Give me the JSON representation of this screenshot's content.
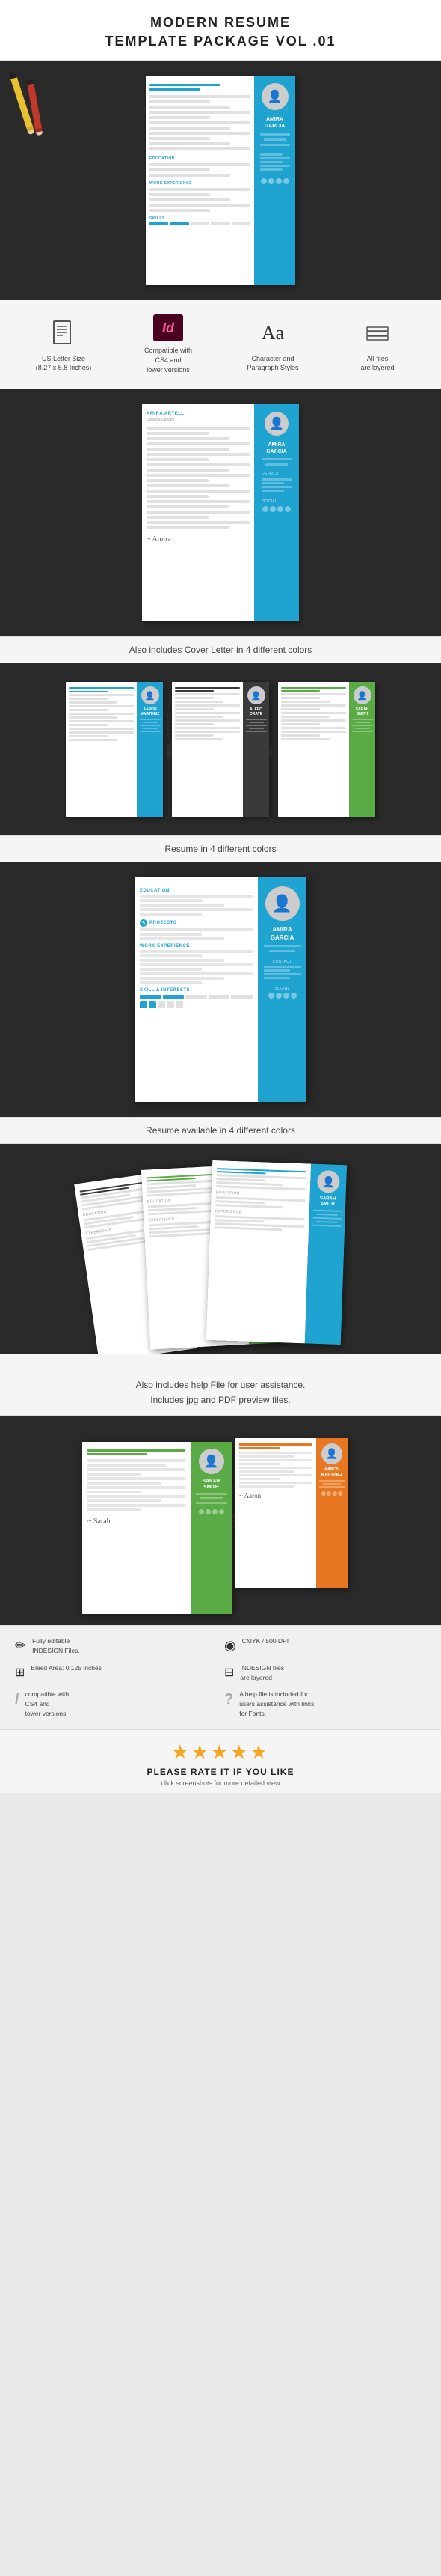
{
  "header": {
    "title": "MODERN RESUME\nTEMPLATE PACKAGE VOL .01"
  },
  "features": [
    {
      "icon_name": "letter-size-icon",
      "icon_symbol": "📄",
      "label": "US Letter Size\n(8.27 x 5.8 Inches)"
    },
    {
      "icon_name": "indesign-icon",
      "icon_symbol": "Id",
      "label": "Compatible with\nCS4 and\nlower versions"
    },
    {
      "icon_name": "typography-icon",
      "icon_symbol": "Aa",
      "label": "Character and\nParagraph Styles"
    },
    {
      "icon_name": "layers-icon",
      "icon_symbol": "⊞",
      "label": "All files\nare layered"
    }
  ],
  "section_labels": {
    "cover_letter": "Also includes Cover Letter in 4 different colors",
    "resume_colors": "Resume in 4 different colors",
    "resume_available": "Resume available in 4 different colors",
    "help_files": "Also includes help File for user assistance.\nIncludes jpg and PDF preview files."
  },
  "bottom_features": [
    {
      "icon_name": "edit-icon",
      "icon_symbol": "✏",
      "text": "Fully editable\nINDESIGN Files."
    },
    {
      "icon_name": "color-icon",
      "icon_symbol": "◉",
      "text": "CMYK / 500 DPI"
    },
    {
      "icon_name": "crop-icon",
      "icon_symbol": "⊞",
      "text": "Bleed Area: 0.125 inches"
    },
    {
      "icon_name": "layers2-icon",
      "icon_symbol": "⊟",
      "text": "INDESIGN files\nare layered"
    },
    {
      "icon_name": "compatible-icon",
      "icon_symbol": "/",
      "text": "compatible with\nCS4 and\ntower versions"
    },
    {
      "icon_name": "help-icon",
      "icon_symbol": "?",
      "text": "A help file is included for\nusers assistance with links\nfor Fonts."
    }
  ],
  "rating": {
    "stars": "★★★★★",
    "title": "PLEASE RATE IT IF YOU LIKE",
    "subtitle": "click  screenshots for more detailed view"
  },
  "names": {
    "amira_garcia": "AMIRA\nGARCIA",
    "aaron_martinez": "AARON\nMARTINEZ",
    "alfeo_orate": "ALFEO\nORATE",
    "sarah_smith": "SARAH\nSMITH"
  },
  "colors": {
    "blue": "#1fa3d0",
    "dark": "#3a3a3a",
    "green": "#5aab46",
    "orange": "#e87722",
    "bg_dark": "#2a2a2a",
    "bg_light": "#f5f5f5",
    "star": "#f5a623"
  }
}
